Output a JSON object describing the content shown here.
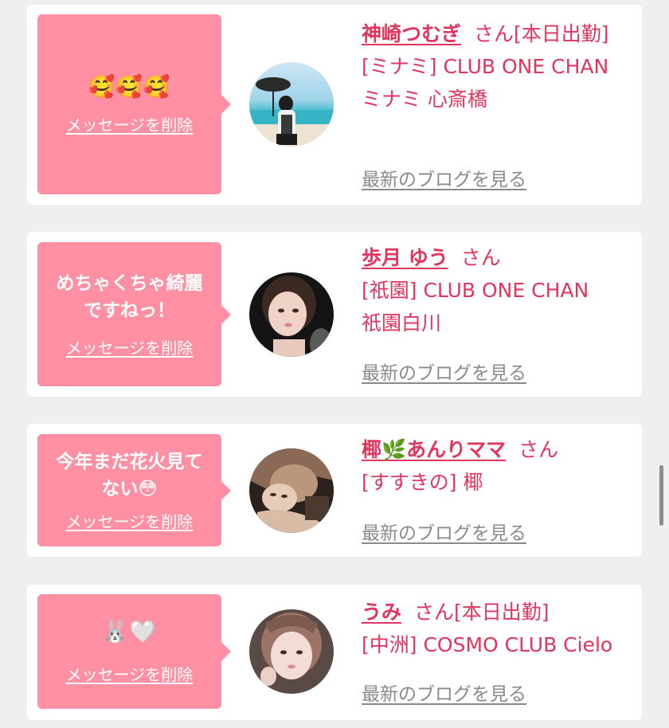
{
  "delete_label": "メッセージを削除",
  "blog_label": "最新のブログを見る",
  "san": "さん",
  "colors": {
    "bubble": "#ff8fa2",
    "accent": "#e0365e",
    "link_gray": "#8a8a8a",
    "background": "#efefef"
  },
  "cards": [
    {
      "message": "🥰🥰🥰",
      "name": "神崎つむぎ",
      "status": "[本日出勤]",
      "shop_line1": "[ミナミ] CLUB ONE CHAN",
      "shop_line2": "ミナミ 心斎橋"
    },
    {
      "message": "めちゃくちゃ綺麗\nですねっ！",
      "name": "歩月 ゆう",
      "status": "",
      "shop_line1": "[祇園] CLUB ONE CHAN",
      "shop_line2": "祇園白川"
    },
    {
      "message": "今年まだ花火見て\nない😳",
      "name": "椰🌿あんりママ",
      "status": "",
      "shop_line1": "[すすきの] 椰",
      "shop_line2": ""
    },
    {
      "message": "🐰🤍",
      "name": "うみ",
      "status": "[本日出勤]",
      "shop_line1": "[中洲] COSMO CLUB Cielo",
      "shop_line2": ""
    }
  ]
}
